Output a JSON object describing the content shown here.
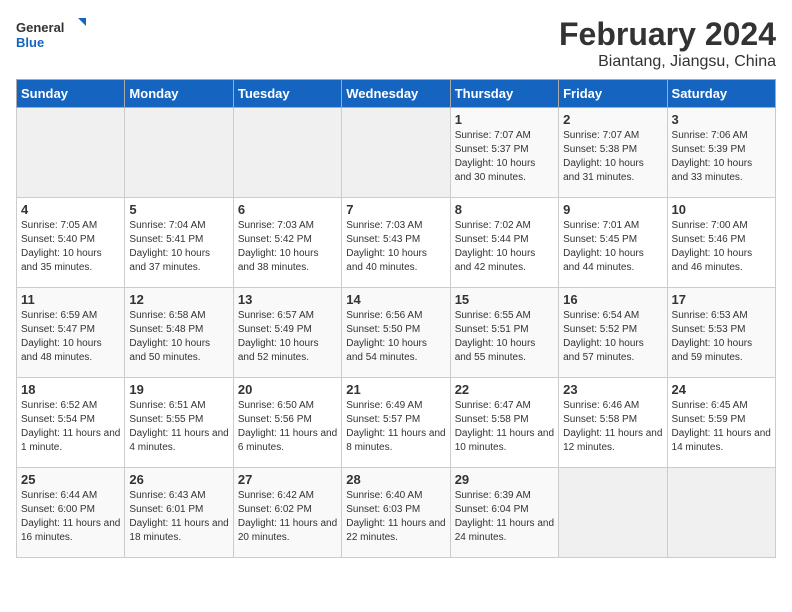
{
  "header": {
    "logo_general": "General",
    "logo_blue": "Blue",
    "title": "February 2024",
    "subtitle": "Biantang, Jiangsu, China"
  },
  "weekdays": [
    "Sunday",
    "Monday",
    "Tuesday",
    "Wednesday",
    "Thursday",
    "Friday",
    "Saturday"
  ],
  "weeks": [
    [
      {
        "day": "",
        "empty": true
      },
      {
        "day": "",
        "empty": true
      },
      {
        "day": "",
        "empty": true
      },
      {
        "day": "",
        "empty": true
      },
      {
        "day": "1",
        "sunrise": "Sunrise: 7:07 AM",
        "sunset": "Sunset: 5:37 PM",
        "daylight": "Daylight: 10 hours and 30 minutes."
      },
      {
        "day": "2",
        "sunrise": "Sunrise: 7:07 AM",
        "sunset": "Sunset: 5:38 PM",
        "daylight": "Daylight: 10 hours and 31 minutes."
      },
      {
        "day": "3",
        "sunrise": "Sunrise: 7:06 AM",
        "sunset": "Sunset: 5:39 PM",
        "daylight": "Daylight: 10 hours and 33 minutes."
      }
    ],
    [
      {
        "day": "4",
        "sunrise": "Sunrise: 7:05 AM",
        "sunset": "Sunset: 5:40 PM",
        "daylight": "Daylight: 10 hours and 35 minutes."
      },
      {
        "day": "5",
        "sunrise": "Sunrise: 7:04 AM",
        "sunset": "Sunset: 5:41 PM",
        "daylight": "Daylight: 10 hours and 37 minutes."
      },
      {
        "day": "6",
        "sunrise": "Sunrise: 7:03 AM",
        "sunset": "Sunset: 5:42 PM",
        "daylight": "Daylight: 10 hours and 38 minutes."
      },
      {
        "day": "7",
        "sunrise": "Sunrise: 7:03 AM",
        "sunset": "Sunset: 5:43 PM",
        "daylight": "Daylight: 10 hours and 40 minutes."
      },
      {
        "day": "8",
        "sunrise": "Sunrise: 7:02 AM",
        "sunset": "Sunset: 5:44 PM",
        "daylight": "Daylight: 10 hours and 42 minutes."
      },
      {
        "day": "9",
        "sunrise": "Sunrise: 7:01 AM",
        "sunset": "Sunset: 5:45 PM",
        "daylight": "Daylight: 10 hours and 44 minutes."
      },
      {
        "day": "10",
        "sunrise": "Sunrise: 7:00 AM",
        "sunset": "Sunset: 5:46 PM",
        "daylight": "Daylight: 10 hours and 46 minutes."
      }
    ],
    [
      {
        "day": "11",
        "sunrise": "Sunrise: 6:59 AM",
        "sunset": "Sunset: 5:47 PM",
        "daylight": "Daylight: 10 hours and 48 minutes."
      },
      {
        "day": "12",
        "sunrise": "Sunrise: 6:58 AM",
        "sunset": "Sunset: 5:48 PM",
        "daylight": "Daylight: 10 hours and 50 minutes."
      },
      {
        "day": "13",
        "sunrise": "Sunrise: 6:57 AM",
        "sunset": "Sunset: 5:49 PM",
        "daylight": "Daylight: 10 hours and 52 minutes."
      },
      {
        "day": "14",
        "sunrise": "Sunrise: 6:56 AM",
        "sunset": "Sunset: 5:50 PM",
        "daylight": "Daylight: 10 hours and 54 minutes."
      },
      {
        "day": "15",
        "sunrise": "Sunrise: 6:55 AM",
        "sunset": "Sunset: 5:51 PM",
        "daylight": "Daylight: 10 hours and 55 minutes."
      },
      {
        "day": "16",
        "sunrise": "Sunrise: 6:54 AM",
        "sunset": "Sunset: 5:52 PM",
        "daylight": "Daylight: 10 hours and 57 minutes."
      },
      {
        "day": "17",
        "sunrise": "Sunrise: 6:53 AM",
        "sunset": "Sunset: 5:53 PM",
        "daylight": "Daylight: 10 hours and 59 minutes."
      }
    ],
    [
      {
        "day": "18",
        "sunrise": "Sunrise: 6:52 AM",
        "sunset": "Sunset: 5:54 PM",
        "daylight": "Daylight: 11 hours and 1 minute."
      },
      {
        "day": "19",
        "sunrise": "Sunrise: 6:51 AM",
        "sunset": "Sunset: 5:55 PM",
        "daylight": "Daylight: 11 hours and 4 minutes."
      },
      {
        "day": "20",
        "sunrise": "Sunrise: 6:50 AM",
        "sunset": "Sunset: 5:56 PM",
        "daylight": "Daylight: 11 hours and 6 minutes."
      },
      {
        "day": "21",
        "sunrise": "Sunrise: 6:49 AM",
        "sunset": "Sunset: 5:57 PM",
        "daylight": "Daylight: 11 hours and 8 minutes."
      },
      {
        "day": "22",
        "sunrise": "Sunrise: 6:47 AM",
        "sunset": "Sunset: 5:58 PM",
        "daylight": "Daylight: 11 hours and 10 minutes."
      },
      {
        "day": "23",
        "sunrise": "Sunrise: 6:46 AM",
        "sunset": "Sunset: 5:58 PM",
        "daylight": "Daylight: 11 hours and 12 minutes."
      },
      {
        "day": "24",
        "sunrise": "Sunrise: 6:45 AM",
        "sunset": "Sunset: 5:59 PM",
        "daylight": "Daylight: 11 hours and 14 minutes."
      }
    ],
    [
      {
        "day": "25",
        "sunrise": "Sunrise: 6:44 AM",
        "sunset": "Sunset: 6:00 PM",
        "daylight": "Daylight: 11 hours and 16 minutes."
      },
      {
        "day": "26",
        "sunrise": "Sunrise: 6:43 AM",
        "sunset": "Sunset: 6:01 PM",
        "daylight": "Daylight: 11 hours and 18 minutes."
      },
      {
        "day": "27",
        "sunrise": "Sunrise: 6:42 AM",
        "sunset": "Sunset: 6:02 PM",
        "daylight": "Daylight: 11 hours and 20 minutes."
      },
      {
        "day": "28",
        "sunrise": "Sunrise: 6:40 AM",
        "sunset": "Sunset: 6:03 PM",
        "daylight": "Daylight: 11 hours and 22 minutes."
      },
      {
        "day": "29",
        "sunrise": "Sunrise: 6:39 AM",
        "sunset": "Sunset: 6:04 PM",
        "daylight": "Daylight: 11 hours and 24 minutes."
      },
      {
        "day": "",
        "empty": true
      },
      {
        "day": "",
        "empty": true
      }
    ]
  ]
}
